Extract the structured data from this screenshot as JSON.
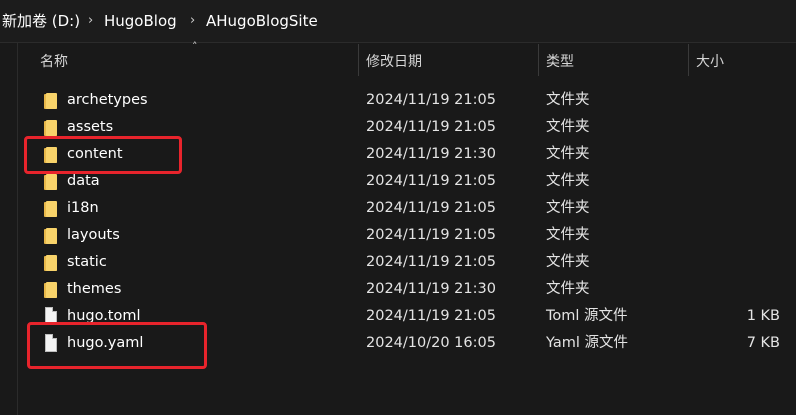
{
  "breadcrumb": {
    "drive": "新加卷 (D:)",
    "folder1": "HugoBlog",
    "folder2": "AHugoBlogSite"
  },
  "columns": {
    "name": "名称",
    "modified": "修改日期",
    "type": "类型",
    "size": "大小"
  },
  "files": [
    {
      "name": "archetypes",
      "modified": "2024/11/19 21:05",
      "type": "文件夹",
      "size": "",
      "icon": "folder-icon"
    },
    {
      "name": "assets",
      "modified": "2024/11/19 21:05",
      "type": "文件夹",
      "size": "",
      "icon": "folder-icon"
    },
    {
      "name": "content",
      "modified": "2024/11/19 21:30",
      "type": "文件夹",
      "size": "",
      "icon": "folder-icon"
    },
    {
      "name": "data",
      "modified": "2024/11/19 21:05",
      "type": "文件夹",
      "size": "",
      "icon": "folder-icon"
    },
    {
      "name": "i18n",
      "modified": "2024/11/19 21:05",
      "type": "文件夹",
      "size": "",
      "icon": "folder-icon"
    },
    {
      "name": "layouts",
      "modified": "2024/11/19 21:05",
      "type": "文件夹",
      "size": "",
      "icon": "folder-icon"
    },
    {
      "name": "static",
      "modified": "2024/11/19 21:05",
      "type": "文件夹",
      "size": "",
      "icon": "folder-icon"
    },
    {
      "name": "themes",
      "modified": "2024/11/19 21:30",
      "type": "文件夹",
      "size": "",
      "icon": "folder-icon"
    },
    {
      "name": "hugo.toml",
      "modified": "2024/11/19 21:05",
      "type": "Toml 源文件",
      "size": "1 KB",
      "icon": "file-icon"
    },
    {
      "name": "hugo.yaml",
      "modified": "2024/10/20 16:05",
      "type": "Yaml 源文件",
      "size": "7 KB",
      "icon": "file-icon"
    }
  ],
  "colors": {
    "highlight": "#e8242c",
    "folder": "#f8d36a",
    "background": "#191919"
  }
}
